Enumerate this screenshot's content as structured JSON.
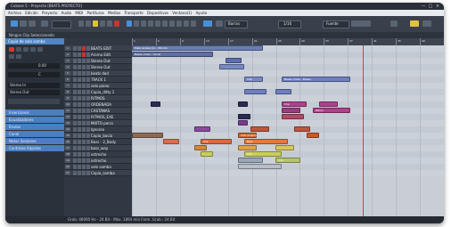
{
  "titlebar": {
    "title": "Cubase 5 - Proyecto [BEATS PROYECTO]",
    "minimize": "—",
    "maximize": "□",
    "close": "×"
  },
  "menu": [
    "Archivo",
    "Edición",
    "Proyecto",
    "Audio",
    "MIDI",
    "Partituras",
    "Medios",
    "Transporte",
    "Dispositivos",
    "Ventana(1)",
    "Ayuda"
  ],
  "toolbar": {
    "quantize": "Barras",
    "grid": "1/16",
    "zoom": "Fuente"
  },
  "infoline": "Ningún Clip Seleccionado",
  "inspector": {
    "header": "Copia de solo samba",
    "volume": "0.00",
    "pan": "C",
    "route_in": "Stereo In",
    "route_out": "Stereo Out",
    "sections": [
      "Inserciones",
      "Ecualizadores",
      "Envíos",
      "Canal",
      "Notas Sesiones",
      "Controles Rápidos"
    ]
  },
  "tracks": [
    "BEATS EDIT",
    "Aroma Edit",
    "Stereo Out",
    "Stereo Out",
    "beats dad",
    "TRACK 1",
    "solo piano",
    "Copia_ditty 1",
    "RITMOS",
    "ORDENADA",
    "CASTANAS",
    "RITMOS_EXE",
    "MIXTO percs",
    "Ignoreo",
    "Copia_bacia",
    "Bass - 2_Body",
    "bass_way",
    "ostrecho",
    "ostrecho",
    "solo samba",
    "Copia_samba"
  ],
  "ruler": [
    "1",
    "5",
    "9",
    "13",
    "17",
    "21",
    "25",
    "29",
    "33",
    "37",
    "41",
    "45",
    "49"
  ],
  "clips": [
    {
      "lane": 0,
      "start": 0.0,
      "len": 0.42,
      "color": "#6a7db3",
      "label": "Pista Grabación - Edición"
    },
    {
      "lane": 1,
      "start": 0.0,
      "len": 0.26,
      "color": "#5f6ea3",
      "label": "Bases Crisis - Sonia"
    },
    {
      "lane": 2,
      "start": 0.3,
      "len": 0.05,
      "color": "#5b6fae",
      "label": ""
    },
    {
      "lane": 3,
      "start": 0.28,
      "len": 0.08,
      "color": "#7888c4",
      "label": ""
    },
    {
      "lane": 5,
      "start": 0.36,
      "len": 0.06,
      "color": "#7888c4",
      "label": "Clip"
    },
    {
      "lane": 5,
      "start": 0.48,
      "len": 0.22,
      "color": "#6d7fc0",
      "label": "Bases Crisis - Bases"
    },
    {
      "lane": 7,
      "start": 0.36,
      "len": 0.07,
      "color": "#6d7fc0",
      "label": ""
    },
    {
      "lane": 7,
      "start": 0.46,
      "len": 0.05,
      "color": "#6d7fc0",
      "label": ""
    },
    {
      "lane": 9,
      "start": 0.06,
      "len": 0.03,
      "color": "#2a2a55",
      "label": ""
    },
    {
      "lane": 9,
      "start": 0.34,
      "len": 0.03,
      "color": "#2a2a55",
      "label": ""
    },
    {
      "lane": 9,
      "start": 0.48,
      "len": 0.08,
      "color": "#b0408a",
      "label": "Clip"
    },
    {
      "lane": 9,
      "start": 0.6,
      "len": 0.06,
      "color": "#b0408a",
      "label": ""
    },
    {
      "lane": 10,
      "start": 0.48,
      "len": 0.06,
      "color": "#9c3c7f",
      "label": ""
    },
    {
      "lane": 10,
      "start": 0.58,
      "len": 0.12,
      "color": "#b0408a",
      "label": "Ritmo"
    },
    {
      "lane": 11,
      "start": 0.34,
      "len": 0.04,
      "color": "#2a2a55",
      "label": ""
    },
    {
      "lane": 11,
      "start": 0.48,
      "len": 0.07,
      "color": "#b04a66",
      "label": ""
    },
    {
      "lane": 12,
      "start": 0.34,
      "len": 0.03,
      "color": "#7a3b8f",
      "label": ""
    },
    {
      "lane": 13,
      "start": 0.2,
      "len": 0.05,
      "color": "#8a4a9c",
      "label": ""
    },
    {
      "lane": 13,
      "start": 0.38,
      "len": 0.06,
      "color": "#c0553a",
      "label": ""
    },
    {
      "lane": 13,
      "start": 0.52,
      "len": 0.05,
      "color": "#c0553a",
      "label": ""
    },
    {
      "lane": 14,
      "start": 0.0,
      "len": 0.1,
      "color": "#8b6a55",
      "label": ""
    },
    {
      "lane": 14,
      "start": 0.34,
      "len": 0.06,
      "color": "#c8652e",
      "label": "Instrumento"
    },
    {
      "lane": 14,
      "start": 0.56,
      "len": 0.04,
      "color": "#c85a2e",
      "label": ""
    },
    {
      "lane": 15,
      "start": 0.1,
      "len": 0.05,
      "color": "#d7704a",
      "label": ""
    },
    {
      "lane": 15,
      "start": 0.22,
      "len": 0.1,
      "color": "#d86b3e",
      "label": "Clip"
    },
    {
      "lane": 15,
      "start": 0.36,
      "len": 0.14,
      "color": "#e07a3e",
      "label": "Bajo"
    },
    {
      "lane": 16,
      "start": 0.2,
      "len": 0.04,
      "color": "#cf8a3e",
      "label": ""
    },
    {
      "lane": 16,
      "start": 0.34,
      "len": 0.06,
      "color": "#dda24a",
      "label": ""
    },
    {
      "lane": 16,
      "start": 0.46,
      "len": 0.06,
      "color": "#d9c55a",
      "label": ""
    },
    {
      "lane": 17,
      "start": 0.22,
      "len": 0.04,
      "color": "#c8cf58",
      "label": ""
    },
    {
      "lane": 17,
      "start": 0.36,
      "len": 0.12,
      "color": "#c8cf58",
      "label": "Clip"
    },
    {
      "lane": 18,
      "start": 0.34,
      "len": 0.08,
      "color": "#9aa7b6",
      "label": ""
    },
    {
      "lane": 18,
      "start": 0.46,
      "len": 0.08,
      "color": "#b6c46a",
      "label": "Clip"
    },
    {
      "lane": 19,
      "start": 0.34,
      "len": 0.14,
      "color": "#b7bec8",
      "label": ""
    }
  ],
  "cursor": 0.74,
  "status": "Grab: 48000 Hz - 24 Bit - Máx. 1894 min    Form. Grab.: 24 Bit"
}
